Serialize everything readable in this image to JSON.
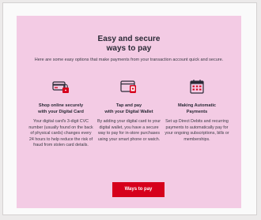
{
  "section": {
    "title_line1": "Easy and secure",
    "title_line2": "ways to pay",
    "intro": "Here are some easy options that make payments from your transaction account quick and secure."
  },
  "options": [
    {
      "icon": "card-lock-icon",
      "title_line1": "Shop online securely",
      "title_line2": "with your Digital Card",
      "body": "Your digital card's 3-digit CVC number (usually found on the back of physical cards) changes every 24 hours to help reduce the risk of fraud from stolen card details."
    },
    {
      "icon": "wallet-phone-icon",
      "title_line1": "Tap and pay",
      "title_line2": "with your Digital Wallet",
      "body": "By adding your digital card to your digital wallet, you have a secure way to pay for in-store purchases using your smart phone or watch."
    },
    {
      "icon": "calendar-icon",
      "title_line1": "Making Automatic",
      "title_line2": "Payments",
      "body": "Set up Direct Debits and recurring payments to automatically pay for your ongoing subscriptions, bills or memberships."
    }
  ],
  "cta": {
    "label": "Ways to pay"
  },
  "colors": {
    "panel_bg": "#f3cbe4",
    "accent": "#d6001c",
    "text": "#2a2a36"
  }
}
